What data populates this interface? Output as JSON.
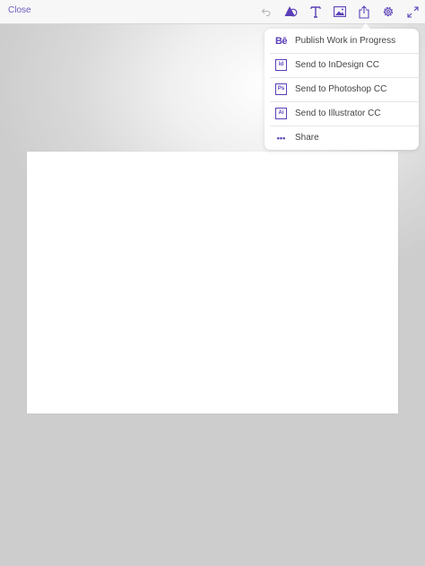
{
  "toolbar": {
    "close_label": "Close",
    "icons": [
      "undo-icon",
      "shapes-icon",
      "text-icon",
      "image-icon",
      "share-icon",
      "gear-icon",
      "expand-icon"
    ],
    "accent_color": "#6f5cc0"
  },
  "share_menu": {
    "items": [
      {
        "label": "Publish Work in Progress",
        "icon": "behance-icon",
        "badge": "Bē"
      },
      {
        "label": "Send to InDesign CC",
        "icon": "indesign-icon",
        "badge": "Id"
      },
      {
        "label": "Send to Photoshop CC",
        "icon": "photoshop-icon",
        "badge": "Ps"
      },
      {
        "label": "Send to Illustrator CC",
        "icon": "illustrator-icon",
        "badge": "Ai"
      },
      {
        "label": "Share",
        "icon": "more-dots-icon",
        "badge": "•••"
      }
    ]
  }
}
